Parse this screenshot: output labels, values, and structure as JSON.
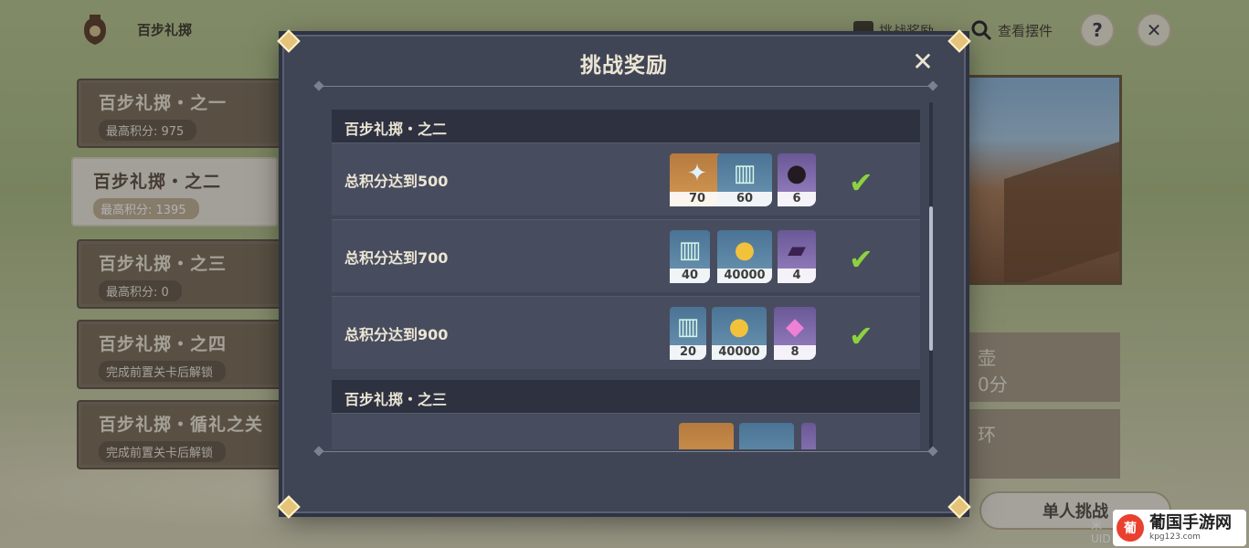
{
  "topbar": {
    "title": "百步礼掷",
    "challenge_reward_label": "挑战奖励",
    "view_decor_label": "查看摆件",
    "help_label": "?",
    "close_label": "✕"
  },
  "stages": [
    {
      "name": "百步礼掷・之一",
      "sub": "最高积分: 975"
    },
    {
      "name": "百步礼掷・之二",
      "sub": "最高积分: 1395"
    },
    {
      "name": "百步礼掷・之三",
      "sub": "最高积分: 0"
    },
    {
      "name": "百步礼掷・之四",
      "sub": "完成前置关卡后解锁"
    },
    {
      "name": "百步礼掷・循礼之关",
      "sub": "完成前置关卡后解锁"
    }
  ],
  "right_panel": {
    "card1_text": "壶\n0分",
    "card2_text": "环",
    "solo_button": "单人挑战",
    "uid_text": "米\nUID"
  },
  "watermark": {
    "name": "葡国手游网",
    "url": "kpg123.com",
    "logo_char": "葡"
  },
  "modal": {
    "title": "挑战奖励",
    "close_label": "✕",
    "groups": [
      {
        "title": "百步礼掷・之二",
        "rows": [
          {
            "label": "总积分达到500",
            "items": [
              {
                "icon": "primogem-icon",
                "qty": "70"
              },
              {
                "icon": "wisdom-crown-icon",
                "qty": "60"
              },
              {
                "icon": "cannonball-icon",
                "qty": "6"
              }
            ],
            "completed": true
          },
          {
            "label": "总积分达到700",
            "items": [
              {
                "icon": "wisdom-crown-icon",
                "qty": "40"
              },
              {
                "icon": "mora-coin-icon",
                "qty": "40000"
              },
              {
                "icon": "purple-book-icon",
                "qty": "4"
              }
            ],
            "completed": true
          },
          {
            "label": "总积分达到900",
            "items": [
              {
                "icon": "wisdom-crown-icon",
                "qty": "20"
              },
              {
                "icon": "mora-coin-icon",
                "qty": "40000"
              },
              {
                "icon": "pink-crystal-icon",
                "qty": "8"
              }
            ],
            "completed": true
          }
        ]
      },
      {
        "title": "百步礼掷・之三"
      }
    ]
  },
  "colors": {
    "modal_bg": "#3f4555",
    "header_bg": "#2d3140",
    "check_green": "#8ed13f",
    "corner_gold": "#e5c37a"
  }
}
